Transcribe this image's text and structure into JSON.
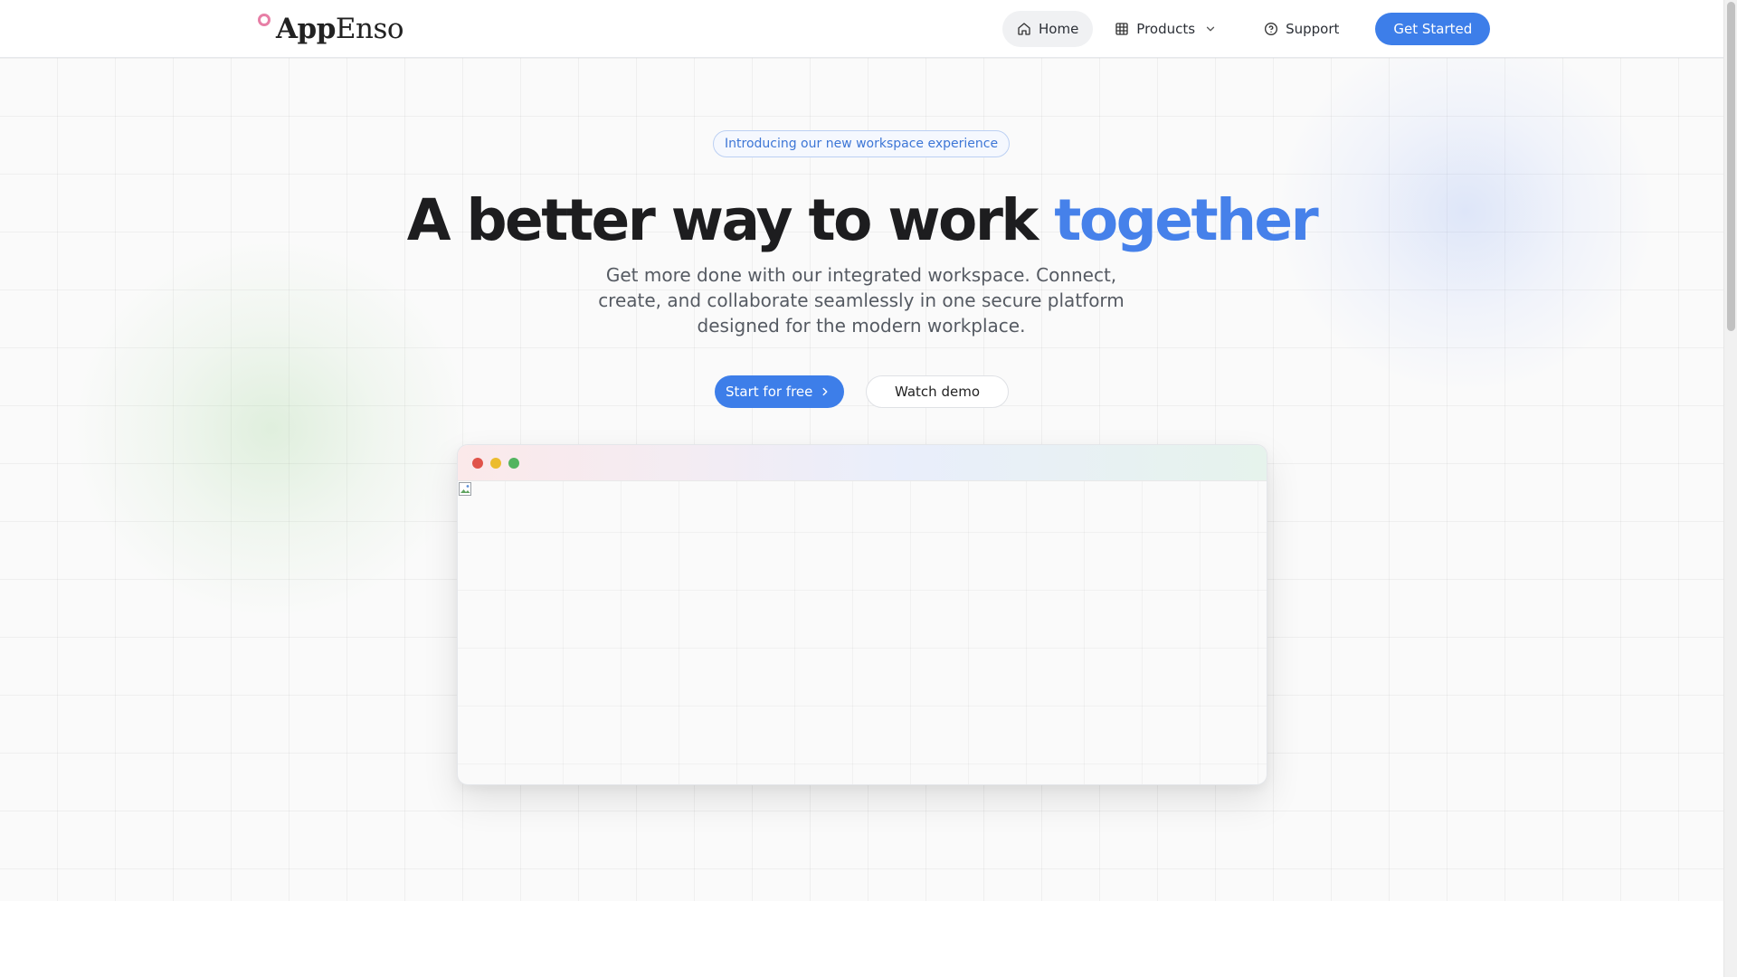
{
  "brand": {
    "name_bold": "App",
    "name_rest": "Enso",
    "ring_color": "#e77fa6"
  },
  "nav": {
    "items": [
      {
        "label": "Home",
        "icon": "home-icon",
        "active": true
      },
      {
        "label": "Products",
        "icon": "grid-icon",
        "has_dropdown": true
      },
      {
        "label": "Support",
        "icon": "help-circle-icon"
      }
    ],
    "cta_label": "Get Started"
  },
  "hero": {
    "badge": "Introducing our new workspace experience",
    "headline_main": "A better way to work ",
    "headline_accent": "together",
    "subhead": "Get more done with our integrated workspace. Connect, create, and collaborate seamlessly in one secure platform designed for the modern workplace.",
    "primary_cta": "Start for free",
    "secondary_cta": "Watch demo"
  },
  "colors": {
    "primary": "#3d7ee9",
    "accent_text": "#4681ea",
    "window_dot_red": "#e0534a",
    "window_dot_yellow": "#ecbc2e",
    "window_dot_green": "#52b45f"
  }
}
